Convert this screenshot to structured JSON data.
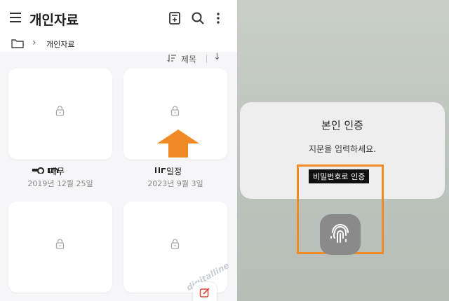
{
  "left": {
    "title": "개인자료",
    "breadcrumb": "개인자료",
    "sort_label": "제목",
    "items": [
      {
        "name": "",
        "date": ""
      },
      {
        "name": "",
        "date": ""
      },
      {
        "name": "재무",
        "date": "2019년 12월 25일"
      },
      {
        "name": "일정",
        "date": "2023년 9월 3일"
      }
    ],
    "watermark": "digitalline"
  },
  "right": {
    "dialog_title": "본인 인증",
    "dialog_subtitle": "지문을 입력하세요.",
    "password_button": "비밀번호로 인증"
  },
  "colors": {
    "accent_orange": "#f08a24",
    "background_left": "#f6f6f8"
  }
}
